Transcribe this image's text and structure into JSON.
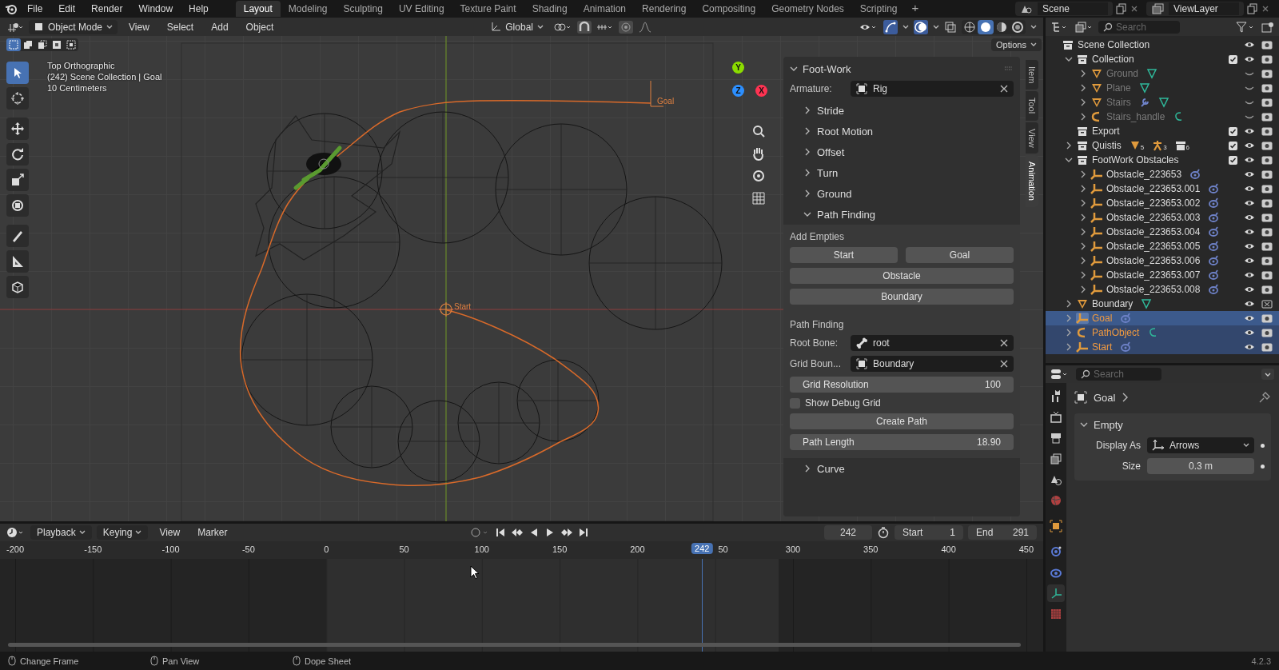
{
  "topbar": {
    "menus": [
      "File",
      "Edit",
      "Render",
      "Window",
      "Help"
    ],
    "workspaces": [
      {
        "label": "Layout",
        "selected": true
      },
      {
        "label": "Modeling",
        "selected": false
      },
      {
        "label": "Sculpting",
        "selected": false
      },
      {
        "label": "UV Editing",
        "selected": false
      },
      {
        "label": "Texture Paint",
        "selected": false
      },
      {
        "label": "Shading",
        "selected": false
      },
      {
        "label": "Animation",
        "selected": false
      },
      {
        "label": "Rendering",
        "selected": false
      },
      {
        "label": "Compositing",
        "selected": false
      },
      {
        "label": "Geometry Nodes",
        "selected": false
      },
      {
        "label": "Scripting",
        "selected": false
      }
    ],
    "add_workspace": "+",
    "scene": "Scene",
    "view_layer": "ViewLayer"
  },
  "viewport": {
    "header": {
      "mode": "Object Mode",
      "menus": [
        "View",
        "Select",
        "Add",
        "Object"
      ],
      "orientation": "Global",
      "shading": [
        {
          "kind": "wireframe",
          "selected": false
        },
        {
          "kind": "solid",
          "selected": true
        },
        {
          "kind": "material",
          "selected": false
        },
        {
          "kind": "rendered",
          "selected": false
        }
      ]
    },
    "select_modes": [
      {
        "kind": "new",
        "selected": true
      },
      {
        "kind": "extend",
        "selected": false
      },
      {
        "kind": "subtract",
        "selected": false
      },
      {
        "kind": "invert",
        "selected": false
      },
      {
        "kind": "intersect",
        "selected": false
      }
    ],
    "options": "Options",
    "overlay_lines": [
      "Top Orthographic",
      "(242) Scene Collection | Goal",
      "10 Centimeters"
    ],
    "tools": [
      {
        "kind": "select",
        "selected": true
      },
      {
        "kind": "cursor",
        "selected": false
      },
      {
        "kind": "move",
        "selected": false
      },
      {
        "kind": "rotate",
        "selected": false
      },
      {
        "kind": "scale",
        "selected": false
      },
      {
        "kind": "transform",
        "selected": false
      },
      {
        "kind": "annotate",
        "selected": false
      },
      {
        "kind": "measure",
        "selected": false
      },
      {
        "kind": "add_cube",
        "selected": false
      }
    ],
    "gizmo_axes": [
      {
        "label": "Y",
        "color": "#8bdc00"
      },
      {
        "label": "Z",
        "color": "#2c8fff"
      },
      {
        "label": "X",
        "color": "#ff3352"
      }
    ],
    "start_label": "Start",
    "goal_label": "Goal",
    "sidebar_tabs": [
      {
        "label": "Item",
        "selected": false
      },
      {
        "label": "Tool",
        "selected": false
      },
      {
        "label": "View",
        "selected": false
      },
      {
        "label": "Animation",
        "selected": true
      }
    ],
    "panel": {
      "title": "Foot-Work",
      "armature_label": "Armature:",
      "armature": "Rig",
      "subpanels": [
        {
          "label": "Stride",
          "expanded": false
        },
        {
          "label": "Root Motion",
          "expanded": false
        },
        {
          "label": "Offset",
          "expanded": false
        },
        {
          "label": "Turn",
          "expanded": false
        },
        {
          "label": "Ground",
          "expanded": false
        },
        {
          "label": "Path Finding",
          "expanded": true
        },
        {
          "label": "Curve",
          "expanded": false
        }
      ],
      "add_empties_title": "Add Empties",
      "start_button": "Start",
      "goal_button": "Goal",
      "obstacle_button": "Obstacle",
      "boundary_button": "Boundary",
      "path_finding_title": "Path Finding",
      "root_bone_label": "Root Bone:",
      "root_bone": "root",
      "grid_bounds_label": "Grid Boun...",
      "grid_bounds": "Boundary",
      "grid_resolution_label": "Grid Resolution",
      "grid_resolution": "100",
      "debug_grid": {
        "label": "Show Debug Grid",
        "checked": false
      },
      "create_path": "Create Path",
      "path_length_label": "Path Length",
      "path_length": "18.90"
    }
  },
  "outliner": {
    "search_placeholder": "Search",
    "tree": [
      {
        "name": "Scene Collection",
        "kind": "scene_collection",
        "selected": false,
        "visible": true,
        "renderable": true,
        "children": [
          {
            "name": "Collection",
            "kind": "collection",
            "selected": false,
            "checked": true,
            "visible": true,
            "renderable": true,
            "expanded": true,
            "children": [
              {
                "name": "Ground",
                "kind": "mesh",
                "selected": false,
                "visible": false,
                "renderable": true,
                "expanded": false,
                "badges": [
                  {
                    "kind": "mesh_data"
                  }
                ]
              },
              {
                "name": "Plane",
                "kind": "mesh",
                "selected": false,
                "visible": false,
                "renderable": true,
                "expanded": false,
                "badges": [
                  {
                    "kind": "mesh_data"
                  }
                ]
              },
              {
                "name": "Stairs",
                "kind": "mesh",
                "selected": false,
                "visible": false,
                "renderable": true,
                "expanded": false,
                "badges": [
                  {
                    "kind": "modifier"
                  },
                  {
                    "kind": "mesh_data"
                  }
                ]
              },
              {
                "name": "Stairs_handle",
                "kind": "curve",
                "selected": false,
                "visible": false,
                "renderable": true,
                "expanded": false,
                "badges": [
                  {
                    "kind": "curve_data"
                  }
                ]
              }
            ]
          },
          {
            "name": "Export",
            "kind": "collection",
            "selected": false,
            "checked": true,
            "visible": true,
            "renderable": true
          },
          {
            "name": "Quistis",
            "kind": "collection",
            "selected": false,
            "checked": true,
            "visible": true,
            "renderable": true,
            "expanded": false,
            "badges": [
              {
                "kind": "mesh",
                "count": "5"
              },
              {
                "kind": "armature",
                "count": "3"
              },
              {
                "kind": "collection",
                "count": "6"
              }
            ]
          },
          {
            "name": "FootWork Obstacles",
            "kind": "collection",
            "selected": false,
            "checked": true,
            "visible": true,
            "renderable": true,
            "expanded": true,
            "children": [
              {
                "name": "Obstacle_223653",
                "kind": "empty",
                "selected": false,
                "visible": true,
                "renderable": true,
                "expanded": false,
                "badges": [
                  {
                    "kind": "constraint"
                  }
                ]
              },
              {
                "name": "Obstacle_223653.001",
                "kind": "empty",
                "selected": false,
                "visible": true,
                "renderable": true,
                "expanded": false,
                "badges": [
                  {
                    "kind": "constraint"
                  }
                ]
              },
              {
                "name": "Obstacle_223653.002",
                "kind": "empty",
                "selected": false,
                "visible": true,
                "renderable": true,
                "expanded": false,
                "badges": [
                  {
                    "kind": "constraint"
                  }
                ]
              },
              {
                "name": "Obstacle_223653.003",
                "kind": "empty",
                "selected": false,
                "visible": true,
                "renderable": true,
                "expanded": false,
                "badges": [
                  {
                    "kind": "constraint"
                  }
                ]
              },
              {
                "name": "Obstacle_223653.004",
                "kind": "empty",
                "selected": false,
                "visible": true,
                "renderable": true,
                "expanded": false,
                "badges": [
                  {
                    "kind": "constraint"
                  }
                ]
              },
              {
                "name": "Obstacle_223653.005",
                "kind": "empty",
                "selected": false,
                "visible": true,
                "renderable": true,
                "expanded": false,
                "badges": [
                  {
                    "kind": "constraint"
                  }
                ]
              },
              {
                "name": "Obstacle_223653.006",
                "kind": "empty",
                "selected": false,
                "visible": true,
                "renderable": true,
                "expanded": false,
                "badges": [
                  {
                    "kind": "constraint"
                  }
                ]
              },
              {
                "name": "Obstacle_223653.007",
                "kind": "empty",
                "selected": false,
                "visible": true,
                "renderable": true,
                "expanded": false,
                "badges": [
                  {
                    "kind": "constraint"
                  }
                ]
              },
              {
                "name": "Obstacle_223653.008",
                "kind": "empty",
                "selected": false,
                "visible": true,
                "renderable": true,
                "expanded": false,
                "badges": [
                  {
                    "kind": "constraint"
                  }
                ]
              }
            ]
          },
          {
            "name": "Boundary",
            "kind": "mesh",
            "selected": false,
            "visible": true,
            "renderable": false,
            "expanded": false,
            "badges": [
              {
                "kind": "mesh_data"
              }
            ]
          },
          {
            "name": "Goal",
            "kind": "empty",
            "selected": true,
            "active": true,
            "visible": true,
            "renderable": true,
            "expanded": false,
            "badges": [
              {
                "kind": "constraint"
              }
            ]
          },
          {
            "name": "PathObject",
            "kind": "curve",
            "selected": true,
            "active": false,
            "visible": true,
            "renderable": true,
            "expanded": false,
            "badges": [
              {
                "kind": "curve_data"
              }
            ]
          },
          {
            "name": "Start",
            "kind": "empty",
            "selected": true,
            "active": false,
            "visible": true,
            "renderable": true,
            "expanded": false,
            "badges": [
              {
                "kind": "constraint"
              }
            ]
          }
        ]
      }
    ]
  },
  "properties": {
    "search_placeholder": "Search",
    "object": "Goal",
    "tabs": [
      {
        "kind": "tool",
        "selected": false
      },
      {
        "kind": "render",
        "selected": false
      },
      {
        "kind": "output",
        "selected": false
      },
      {
        "kind": "view_layer",
        "selected": false
      },
      {
        "kind": "scene",
        "selected": false
      },
      {
        "kind": "world",
        "selected": false
      },
      {
        "kind": "object",
        "selected": false
      },
      {
        "kind": "physics",
        "selected": false
      },
      {
        "kind": "constraints",
        "selected": false
      },
      {
        "kind": "data",
        "selected": true
      },
      {
        "kind": "texture",
        "selected": false
      }
    ],
    "panel": {
      "title": "Empty",
      "expanded": true,
      "display_as_label": "Display As",
      "display_as": "Arrows",
      "size_label": "Size",
      "size": "0.3 m"
    }
  },
  "timeline": {
    "menus": [
      "Playback",
      "Keying",
      "View",
      "Marker"
    ],
    "current_frame": "242",
    "start_label": "Start",
    "start": "1",
    "end_label": "End",
    "end": "291",
    "ticks": [
      "-200",
      "-150",
      "-100",
      "-50",
      "0",
      "50",
      "100",
      "150",
      "200",
      "50",
      "300",
      "350",
      "400",
      "450"
    ],
    "playhead": {
      "label": "242",
      "level": 0.673
    }
  },
  "status_bar": {
    "hints": [
      "Change Frame",
      "Pan View",
      "Dope Sheet"
    ],
    "version": "4.2.3"
  }
}
